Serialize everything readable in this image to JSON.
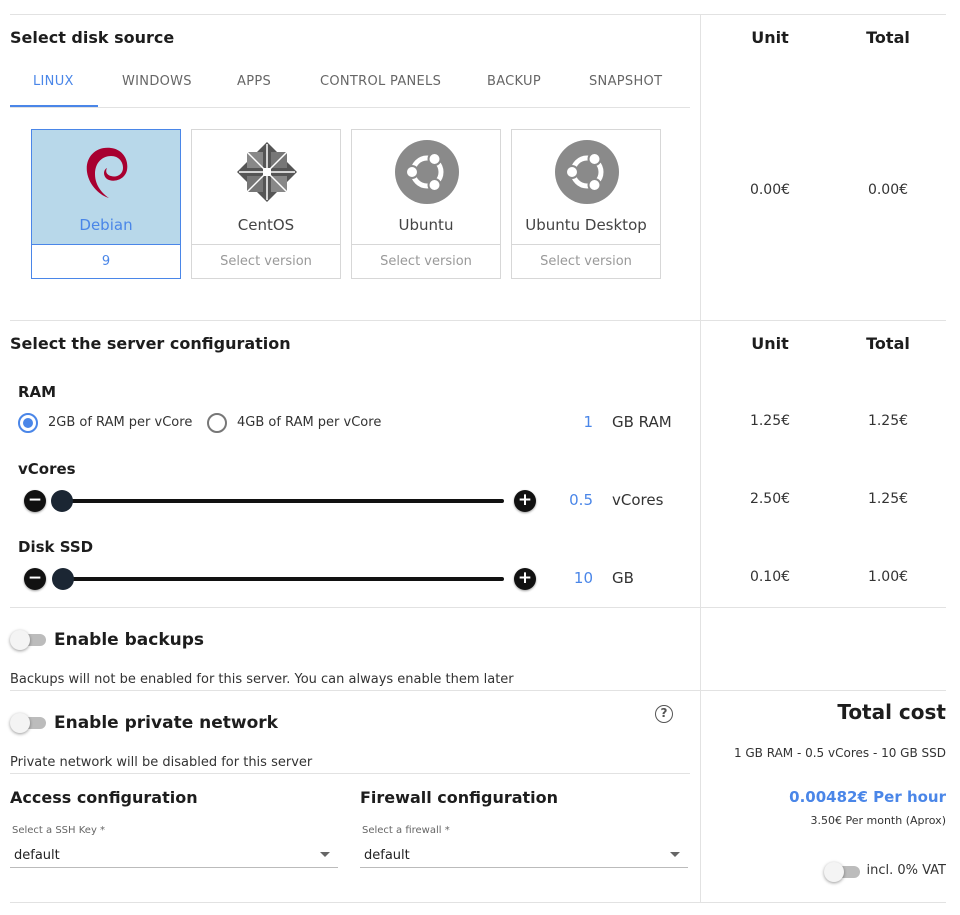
{
  "disk_source": {
    "title": "Select disk source",
    "tabs": [
      {
        "label": "LINUX",
        "active": true
      },
      {
        "label": "WINDOWS",
        "active": false
      },
      {
        "label": "APPS",
        "active": false
      },
      {
        "label": "CONTROL PANELS",
        "active": false
      },
      {
        "label": "BACKUP",
        "active": false
      },
      {
        "label": "SNAPSHOT",
        "active": false
      }
    ],
    "images": [
      {
        "name": "Debian",
        "icon": "debian-logo-icon",
        "version": "9",
        "selected": true
      },
      {
        "name": "CentOS",
        "icon": "centos-logo-icon",
        "version": "Select version",
        "selected": false
      },
      {
        "name": "Ubuntu",
        "icon": "ubuntu-logo-icon",
        "version": "Select version",
        "selected": false
      },
      {
        "name": "Ubuntu Desktop",
        "icon": "ubuntu-logo-icon",
        "version": "Select version",
        "selected": false
      }
    ],
    "unit_header": "Unit",
    "total_header": "Total",
    "unit_price": "0.00€",
    "total_price": "0.00€"
  },
  "server_config": {
    "title": "Select the server configuration",
    "unit_header": "Unit",
    "total_header": "Total",
    "ram": {
      "label": "RAM",
      "option_1": "2GB of RAM per vCore",
      "option_2": "4GB of RAM per vCore",
      "selected": "2GB of RAM per vCore",
      "value": "1",
      "unit": "GB RAM",
      "unit_price": "1.25€",
      "total_price": "1.25€"
    },
    "vcores": {
      "label": "vCores",
      "value": "0.5",
      "unit": "vCores",
      "unit_price": "2.50€",
      "total_price": "1.25€"
    },
    "disk": {
      "label": "Disk SSD",
      "value": "10",
      "unit": "GB",
      "unit_price": "0.10€",
      "total_price": "1.00€"
    }
  },
  "backups": {
    "label": "Enable backups",
    "enabled": false,
    "note": "Backups will not be enabled for this server. You can always enable them later"
  },
  "private_network": {
    "label": "Enable private network",
    "enabled": false,
    "note": "Private network will be disabled for this server"
  },
  "access": {
    "title": "Access configuration",
    "field_label": "Select a SSH Key *",
    "value": "default"
  },
  "firewall": {
    "title": "Firewall configuration",
    "field_label": "Select a firewall *",
    "value": "default"
  },
  "summary": {
    "title": "Total cost",
    "spec": "1 GB RAM - 0.5 vCores - 10 GB SSD",
    "hourly": "0.00482€ Per hour",
    "monthly": "3.50€ Per month (Aprox)",
    "vat_label": "incl. 0% VAT",
    "vat_enabled": false
  },
  "colors": {
    "accent": "#4a86e8",
    "selected_card": "#b8d8ea"
  }
}
